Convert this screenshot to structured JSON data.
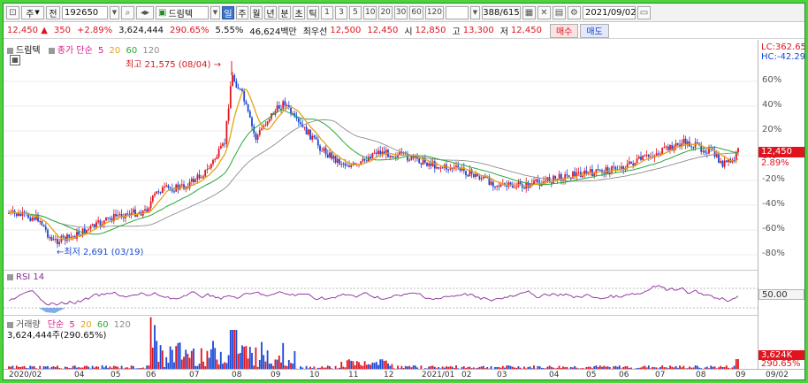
{
  "toolbar": {
    "market_label": "주",
    "jeon_label": "전",
    "stock_code": "192650",
    "stock_name": "드림텍",
    "period_tabs": [
      "일",
      "주",
      "월",
      "년",
      "분",
      "초",
      "틱"
    ],
    "active_period": "일",
    "interval_buttons": [
      "1",
      "3",
      "5",
      "10",
      "20",
      "30",
      "60",
      "120"
    ],
    "page_info": "388/615",
    "date_value": "2021/09/02"
  },
  "quote": {
    "price": "12,450",
    "change_arrow": "▲",
    "change": "350",
    "change_pct": "+2.89%",
    "volume": "3,624,444",
    "vol_ratio": "290.65%",
    "turnover": "5.55%",
    "trade_value": "46,624백만",
    "best_ask_label": "최우선",
    "best_ask": "12,500",
    "best_bid": "12,450",
    "open_label": "시",
    "open": "12,850",
    "high_label": "고",
    "high": "13,300",
    "low_label": "저",
    "low": "12,450",
    "buy_label": "매수",
    "sell_label": "매도"
  },
  "price_panel": {
    "legend_name": "드림텍",
    "legend_ma_label": "종가 단순",
    "ma_periods": [
      "5",
      "20",
      "60",
      "120"
    ],
    "ma_colors": [
      "#d81b8c",
      "#e6a117",
      "#2aa63c",
      "#8c8c8c"
    ],
    "high_annotation": "최고 21,575 (08/04)",
    "low_annotation": "최저 2,691 (03/19)",
    "lc_label": "LC:362.65",
    "hc_label": "HC:-42.29",
    "current_price_tag": "12,450",
    "current_pct_tag": "2.89%"
  },
  "rsi_panel": {
    "label": "RSI 14",
    "level_label": "50.00"
  },
  "volume_panel": {
    "legend_name": "거래량",
    "legend_ma_label": "단순",
    "ma_periods": [
      "5",
      "20",
      "60",
      "120"
    ],
    "current_text": "3,624,444주(290.65%)",
    "vol_tag": "3,624K",
    "vol_pct_tag": "290.65%"
  },
  "y_axis_ticks": [
    "60%",
    "40%",
    "20%",
    "0%",
    "-20%",
    "-40%",
    "-60%",
    "-80%"
  ],
  "x_axis_ticks": [
    "2020/02",
    "04",
    "05",
    "06",
    "07",
    "08",
    "09",
    "10",
    "11",
    "12",
    "2021/01",
    "02",
    "03",
    "04",
    "05",
    "06",
    "07",
    "08",
    "09",
    "09/02"
  ],
  "colors": {
    "frame_border": "#4cd43c",
    "up": "#e0141e",
    "down": "#1a48d6",
    "rsi_line": "#8a2a9a",
    "rsi_fill_low": "#4a8ad8",
    "selected_tab": "#3b73c9"
  }
}
